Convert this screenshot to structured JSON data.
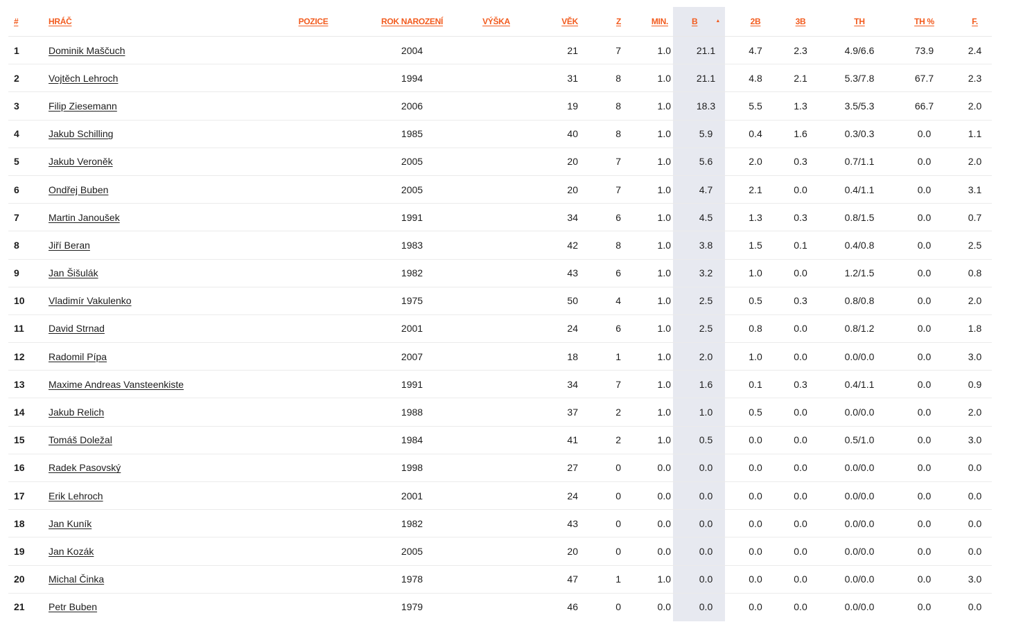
{
  "table": {
    "headers": {
      "rank": "#",
      "player": "HRÁČ",
      "position": "POZICE",
      "birth_year": "ROK NAROZENÍ",
      "height": "VÝŠKA",
      "age": "VĚK",
      "games": "Z",
      "minutes": "MIN.",
      "points": "B",
      "two_pt": "2B",
      "three_pt": "3B",
      "free_throws": "TH",
      "ft_pct": "TH %",
      "fouls": "F."
    },
    "sorted_column": "points",
    "sort_direction": "descending",
    "highlight_color": "#e7e9f0",
    "accent_color": "#f25b1e",
    "rows": [
      {
        "rank": "1",
        "name": "Dominik Maščuch",
        "position": "",
        "year": "2004",
        "height": "",
        "age": "21",
        "games": "7",
        "min": "1.0",
        "pts": "21.1",
        "p2": "4.7",
        "p3": "2.3",
        "ft": "4.9/6.6",
        "ftp": "73.9",
        "fouls": "2.4"
      },
      {
        "rank": "2",
        "name": "Vojtěch Lehroch",
        "position": "",
        "year": "1994",
        "height": "",
        "age": "31",
        "games": "8",
        "min": "1.0",
        "pts": "21.1",
        "p2": "4.8",
        "p3": "2.1",
        "ft": "5.3/7.8",
        "ftp": "67.7",
        "fouls": "2.3"
      },
      {
        "rank": "3",
        "name": "Filip Ziesemann",
        "position": "",
        "year": "2006",
        "height": "",
        "age": "19",
        "games": "8",
        "min": "1.0",
        "pts": "18.3",
        "p2": "5.5",
        "p3": "1.3",
        "ft": "3.5/5.3",
        "ftp": "66.7",
        "fouls": "2.0"
      },
      {
        "rank": "4",
        "name": "Jakub Schilling",
        "position": "",
        "year": "1985",
        "height": "",
        "age": "40",
        "games": "8",
        "min": "1.0",
        "pts": "5.9",
        "p2": "0.4",
        "p3": "1.6",
        "ft": "0.3/0.3",
        "ftp": "0.0",
        "fouls": "1.1"
      },
      {
        "rank": "5",
        "name": "Jakub Veroněk",
        "position": "",
        "year": "2005",
        "height": "",
        "age": "20",
        "games": "7",
        "min": "1.0",
        "pts": "5.6",
        "p2": "2.0",
        "p3": "0.3",
        "ft": "0.7/1.1",
        "ftp": "0.0",
        "fouls": "2.0"
      },
      {
        "rank": "6",
        "name": "Ondřej Buben",
        "position": "",
        "year": "2005",
        "height": "",
        "age": "20",
        "games": "7",
        "min": "1.0",
        "pts": "4.7",
        "p2": "2.1",
        "p3": "0.0",
        "ft": "0.4/1.1",
        "ftp": "0.0",
        "fouls": "3.1"
      },
      {
        "rank": "7",
        "name": "Martin Janoušek",
        "position": "",
        "year": "1991",
        "height": "",
        "age": "34",
        "games": "6",
        "min": "1.0",
        "pts": "4.5",
        "p2": "1.3",
        "p3": "0.3",
        "ft": "0.8/1.5",
        "ftp": "0.0",
        "fouls": "0.7"
      },
      {
        "rank": "8",
        "name": "Jiří Beran",
        "position": "",
        "year": "1983",
        "height": "",
        "age": "42",
        "games": "8",
        "min": "1.0",
        "pts": "3.8",
        "p2": "1.5",
        "p3": "0.1",
        "ft": "0.4/0.8",
        "ftp": "0.0",
        "fouls": "2.5"
      },
      {
        "rank": "9",
        "name": "Jan Šišulák",
        "position": "",
        "year": "1982",
        "height": "",
        "age": "43",
        "games": "6",
        "min": "1.0",
        "pts": "3.2",
        "p2": "1.0",
        "p3": "0.0",
        "ft": "1.2/1.5",
        "ftp": "0.0",
        "fouls": "0.8"
      },
      {
        "rank": "10",
        "name": "Vladimír Vakulenko",
        "position": "",
        "year": "1975",
        "height": "",
        "age": "50",
        "games": "4",
        "min": "1.0",
        "pts": "2.5",
        "p2": "0.5",
        "p3": "0.3",
        "ft": "0.8/0.8",
        "ftp": "0.0",
        "fouls": "2.0"
      },
      {
        "rank": "11",
        "name": "David Strnad",
        "position": "",
        "year": "2001",
        "height": "",
        "age": "24",
        "games": "6",
        "min": "1.0",
        "pts": "2.5",
        "p2": "0.8",
        "p3": "0.0",
        "ft": "0.8/1.2",
        "ftp": "0.0",
        "fouls": "1.8"
      },
      {
        "rank": "12",
        "name": "Radomil Pípa",
        "position": "",
        "year": "2007",
        "height": "",
        "age": "18",
        "games": "1",
        "min": "1.0",
        "pts": "2.0",
        "p2": "1.0",
        "p3": "0.0",
        "ft": "0.0/0.0",
        "ftp": "0.0",
        "fouls": "3.0"
      },
      {
        "rank": "13",
        "name": "Maxime Andreas Vansteenkiste",
        "position": "",
        "year": "1991",
        "height": "",
        "age": "34",
        "games": "7",
        "min": "1.0",
        "pts": "1.6",
        "p2": "0.1",
        "p3": "0.3",
        "ft": "0.4/1.1",
        "ftp": "0.0",
        "fouls": "0.9"
      },
      {
        "rank": "14",
        "name": "Jakub Relich",
        "position": "",
        "year": "1988",
        "height": "",
        "age": "37",
        "games": "2",
        "min": "1.0",
        "pts": "1.0",
        "p2": "0.5",
        "p3": "0.0",
        "ft": "0.0/0.0",
        "ftp": "0.0",
        "fouls": "2.0"
      },
      {
        "rank": "15",
        "name": "Tomáš Doležal",
        "position": "",
        "year": "1984",
        "height": "",
        "age": "41",
        "games": "2",
        "min": "1.0",
        "pts": "0.5",
        "p2": "0.0",
        "p3": "0.0",
        "ft": "0.5/1.0",
        "ftp": "0.0",
        "fouls": "3.0"
      },
      {
        "rank": "16",
        "name": "Radek Pasovský",
        "position": "",
        "year": "1998",
        "height": "",
        "age": "27",
        "games": "0",
        "min": "0.0",
        "pts": "0.0",
        "p2": "0.0",
        "p3": "0.0",
        "ft": "0.0/0.0",
        "ftp": "0.0",
        "fouls": "0.0"
      },
      {
        "rank": "17",
        "name": "Erik Lehroch",
        "position": "",
        "year": "2001",
        "height": "",
        "age": "24",
        "games": "0",
        "min": "0.0",
        "pts": "0.0",
        "p2": "0.0",
        "p3": "0.0",
        "ft": "0.0/0.0",
        "ftp": "0.0",
        "fouls": "0.0"
      },
      {
        "rank": "18",
        "name": "Jan Kuník",
        "position": "",
        "year": "1982",
        "height": "",
        "age": "43",
        "games": "0",
        "min": "0.0",
        "pts": "0.0",
        "p2": "0.0",
        "p3": "0.0",
        "ft": "0.0/0.0",
        "ftp": "0.0",
        "fouls": "0.0"
      },
      {
        "rank": "19",
        "name": "Jan Kozák",
        "position": "",
        "year": "2005",
        "height": "",
        "age": "20",
        "games": "0",
        "min": "0.0",
        "pts": "0.0",
        "p2": "0.0",
        "p3": "0.0",
        "ft": "0.0/0.0",
        "ftp": "0.0",
        "fouls": "0.0"
      },
      {
        "rank": "20",
        "name": "Michal Činka",
        "position": "",
        "year": "1978",
        "height": "",
        "age": "47",
        "games": "1",
        "min": "1.0",
        "pts": "0.0",
        "p2": "0.0",
        "p3": "0.0",
        "ft": "0.0/0.0",
        "ftp": "0.0",
        "fouls": "3.0"
      },
      {
        "rank": "21",
        "name": "Petr Buben",
        "position": "",
        "year": "1979",
        "height": "",
        "age": "46",
        "games": "0",
        "min": "0.0",
        "pts": "0.0",
        "p2": "0.0",
        "p3": "0.0",
        "ft": "0.0/0.0",
        "ftp": "0.0",
        "fouls": "0.0"
      }
    ]
  }
}
